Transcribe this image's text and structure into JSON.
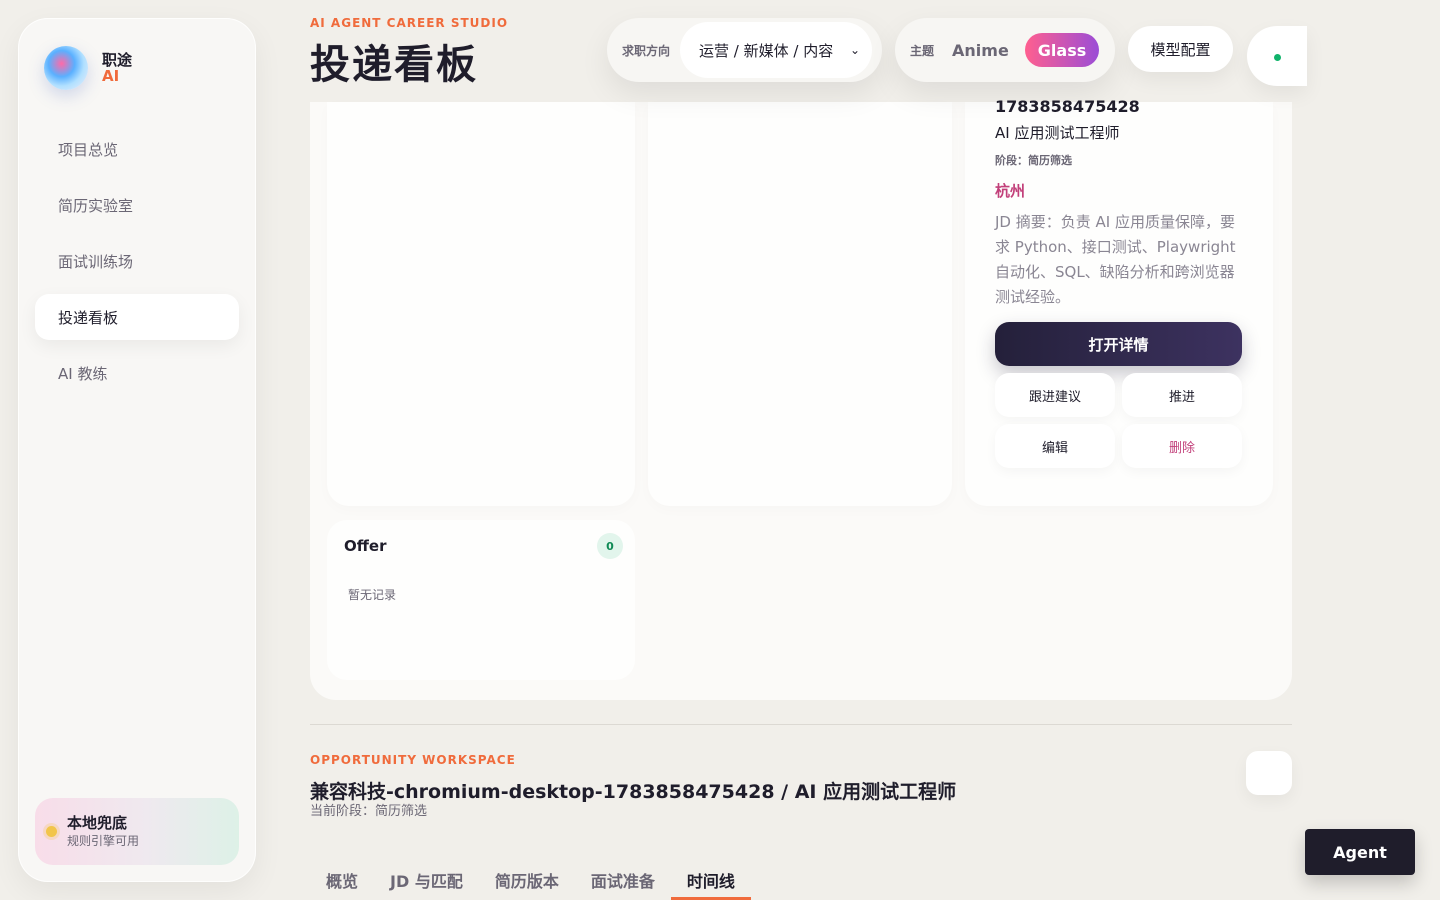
{
  "brand": {
    "name": "职途",
    "ai": "AI"
  },
  "sidebar": {
    "items": [
      {
        "label": "项目总览",
        "active": false
      },
      {
        "label": "简历实验室",
        "active": false
      },
      {
        "label": "面试训练场",
        "active": false
      },
      {
        "label": "投递看板",
        "active": true
      },
      {
        "label": "AI 教练",
        "active": false
      }
    ],
    "engine": {
      "title": "本地兜底",
      "subtitle": "规则引擎可用"
    }
  },
  "header": {
    "eyebrow": "AI AGENT CAREER STUDIO",
    "title": "投递看板",
    "direction_label": "求职方向",
    "direction_value": "运营 / 新媒体 / 内容",
    "theme_label": "主题",
    "themes": [
      {
        "label": "Anime",
        "active": false
      },
      {
        "label": "Glass",
        "active": true
      }
    ],
    "model_config": "模型配置"
  },
  "job_card": {
    "id": "1783858475428",
    "role": "AI 应用测试工程师",
    "stage": "阶段：简历筛选",
    "city": "杭州",
    "jd": "JD 摘要：负责 AI 应用质量保障，要求 Python、接口测试、Playwright 自动化、SQL、缺陷分析和跨浏览器测试经验。",
    "open_detail": "打开详情",
    "follow_up": "跟进建议",
    "advance": "推进",
    "edit": "编辑",
    "delete": "删除"
  },
  "offer_column": {
    "title": "Offer",
    "count": "0",
    "empty": "暂无记录"
  },
  "workspace": {
    "eyebrow": "OPPORTUNITY WORKSPACE",
    "title": "兼容科技-chromium-desktop-1783858475428 / AI 应用测试工程师",
    "stage": "当前阶段：简历筛选",
    "tabs": [
      {
        "label": "概览",
        "active": false
      },
      {
        "label": "JD 与匹配",
        "active": false
      },
      {
        "label": "简历版本",
        "active": false
      },
      {
        "label": "面试准备",
        "active": false
      },
      {
        "label": "时间线",
        "active": true
      }
    ]
  },
  "agent_button": "Agent",
  "colors": {
    "accent": "#f06b3c",
    "dark": "#24203a",
    "city": "#c2407a",
    "status_ok": "#10b36b"
  }
}
